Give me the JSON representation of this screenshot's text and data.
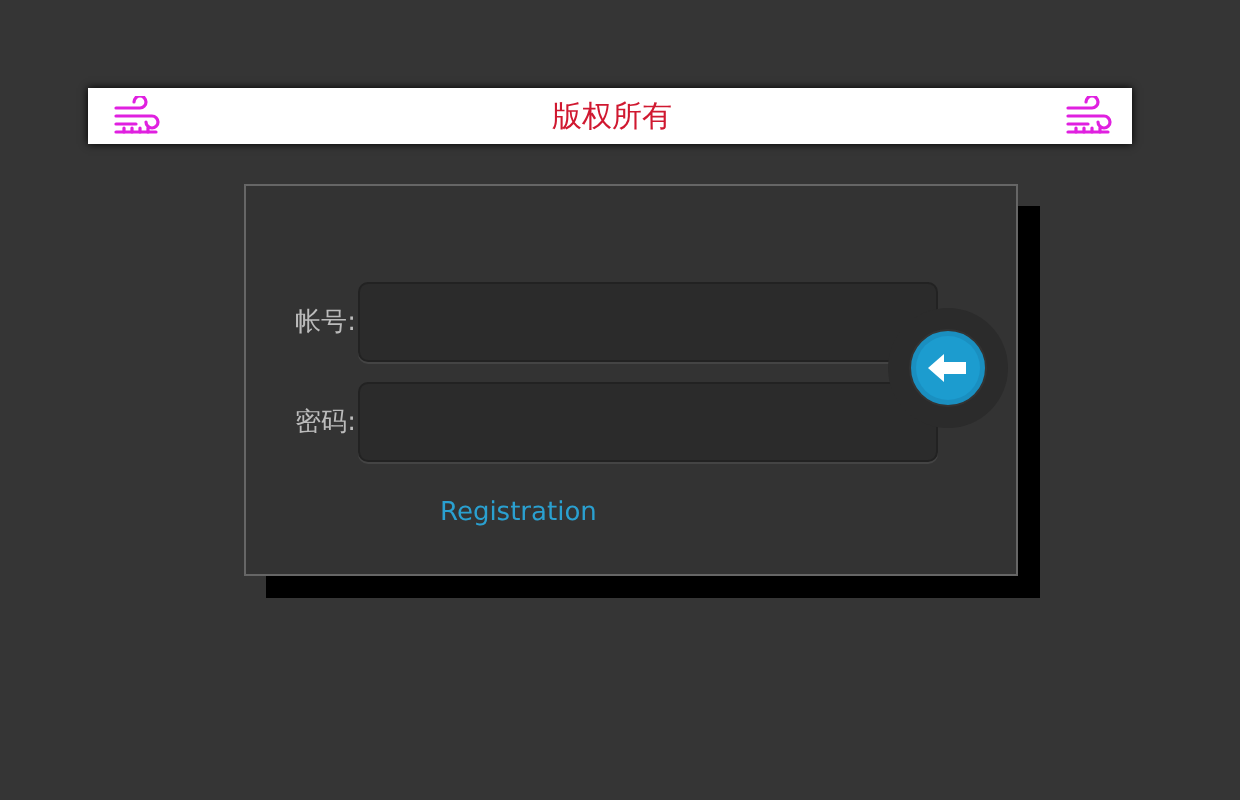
{
  "banner": {
    "title": "版权所有"
  },
  "login": {
    "fields": [
      {
        "label": "帐号:"
      },
      {
        "label": "密码:"
      }
    ],
    "link": "Registration"
  }
}
